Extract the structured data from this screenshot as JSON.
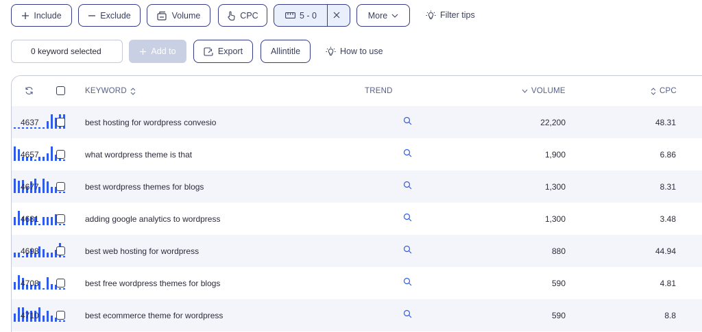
{
  "toolbar": {
    "include_label": "Include",
    "exclude_label": "Exclude",
    "volume_label": "Volume",
    "cpc_label": "CPC",
    "range_label": "5 - 0",
    "more_label": "More",
    "filter_tips_label": "Filter tips"
  },
  "actions": {
    "selected_label": "0 keyword selected",
    "add_to_label": "Add to",
    "export_label": "Export",
    "allintitle_label": "Allintitle",
    "how_to_use_label": "How to use"
  },
  "table": {
    "headers": {
      "keyword": "KEYWORD",
      "trend": "TREND",
      "volume": "VOLUME",
      "cpc": "CPC"
    },
    "rows": [
      {
        "id": "4637",
        "keyword": "best hosting for wordpress convesio",
        "volume": "22,200",
        "cpc": "48.31",
        "trend": [
          0.08,
          0.08,
          0.08,
          0.08,
          0.08,
          0.08,
          0.08,
          0.08,
          0.5,
          1.0,
          0.75,
          1.0,
          1.0
        ]
      },
      {
        "id": "4657",
        "keyword": "what wordpress theme is that",
        "volume": "1,900",
        "cpc": "6.86",
        "trend": [
          1.0,
          0.8,
          0.3,
          0.3,
          0.3,
          0.08,
          0.3,
          0.3,
          0.5,
          1.0,
          0.45,
          0.3,
          0.08
        ]
      },
      {
        "id": "4677",
        "keyword": "best wordpress themes for blogs",
        "volume": "1,300",
        "cpc": "8.31",
        "trend": [
          1.0,
          0.85,
          0.9,
          0.45,
          0.8,
          1.0,
          0.45,
          1.0,
          0.8,
          0.45,
          0.45,
          0.08,
          0.08
        ]
      },
      {
        "id": "4681",
        "keyword": "adding google analytics to wordpress",
        "volume": "1,300",
        "cpc": "3.48",
        "trend": [
          0.55,
          1.0,
          0.55,
          0.55,
          0.55,
          0.55,
          0.08,
          0.55,
          0.55,
          0.55,
          0.75,
          0.08,
          0.08
        ]
      },
      {
        "id": "4698",
        "keyword": "best web hosting for wordpress",
        "volume": "880",
        "cpc": "44.94",
        "trend": [
          0.35,
          0.35,
          0.08,
          0.35,
          0.55,
          0.35,
          0.75,
          0.55,
          0.35,
          0.35,
          0.5,
          1.0,
          0.08
        ]
      },
      {
        "id": "4708",
        "keyword": "best free wordpress themes for blogs",
        "volume": "590",
        "cpc": "4.81",
        "trend": [
          0.5,
          1.0,
          0.8,
          0.35,
          0.35,
          0.35,
          0.55,
          0.08,
          0.85,
          0.4,
          0.35,
          0.08,
          0.08
        ]
      },
      {
        "id": "4710",
        "keyword": "best ecommerce theme for wordpress",
        "volume": "590",
        "cpc": "8.8",
        "trend": [
          0.55,
          1.0,
          1.0,
          0.75,
          0.75,
          0.75,
          1.0,
          0.45,
          0.75,
          0.45,
          0.3,
          0.08,
          0.08
        ]
      }
    ]
  },
  "colors": {
    "accent": "#2f5be8",
    "border": "#343a8a",
    "row_alt": "#f3f5fb"
  }
}
